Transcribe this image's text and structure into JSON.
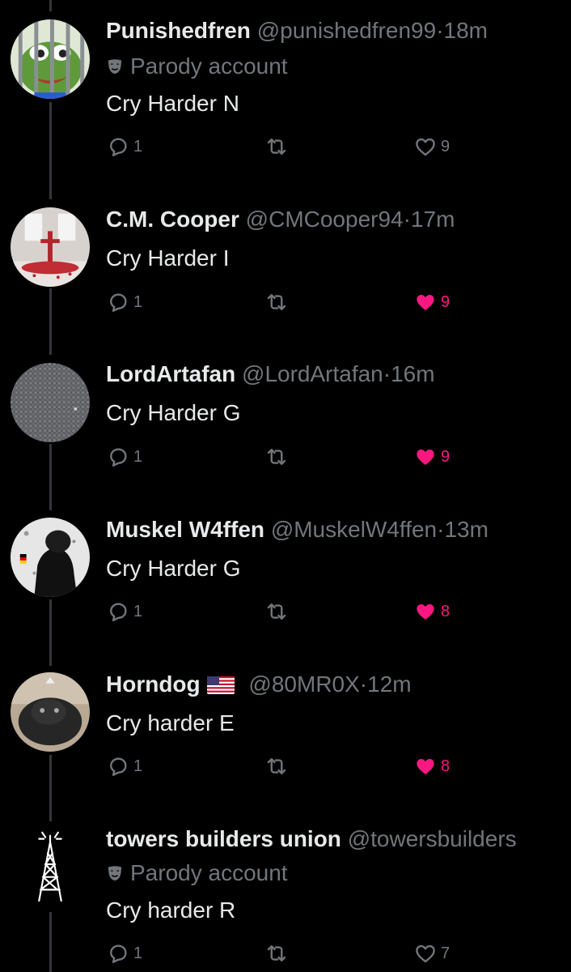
{
  "tweets": [
    {
      "name": "Punishedfren",
      "handle": "@punishedfren99",
      "dot": "·",
      "time": "18m",
      "parody": "Parody account",
      "text": "Cry Harder N",
      "replies": "1",
      "likes": "9",
      "liked": false,
      "avatar_icon": "frog-avatar"
    },
    {
      "name": "C.M. Cooper",
      "handle": "@CMCooper94",
      "dot": "·",
      "time": "17m",
      "text": "Cry Harder I",
      "replies": "1",
      "likes": "9",
      "liked": true,
      "avatar_icon": "cross-room-avatar"
    },
    {
      "name": "LordArtafan",
      "handle": "@LordArtafan",
      "dot": "·",
      "time": "16m",
      "text": "Cry Harder G",
      "replies": "1",
      "likes": "9",
      "liked": true,
      "avatar_icon": "gray-texture-avatar"
    },
    {
      "name": "Muskel W4ffen",
      "handle": "@MuskelW4ffen",
      "dot": "·",
      "time": "13m",
      "text": "Cry Harder G",
      "replies": "1",
      "likes": "8",
      "liked": true,
      "avatar_icon": "soldier-avatar"
    },
    {
      "name": "Horndog",
      "handle": "@80MR0X",
      "dot": "·",
      "time": "12m",
      "flag_icon": "us-flag-icon",
      "text": "Cry harder E",
      "replies": "1",
      "likes": "8",
      "liked": true,
      "avatar_icon": "animal-avatar"
    },
    {
      "name": "towers builders union",
      "handle": "@towersbuilders",
      "parody": "Parody account",
      "text": "Cry harder R",
      "replies": "1",
      "likes": "7",
      "liked": false,
      "avatar_icon": "radio-tower-avatar"
    }
  ],
  "colors": {
    "background": "#000000",
    "text": "#e7e9ea",
    "muted": "#71767b",
    "like": "#f91880",
    "thread_line": "#333639"
  }
}
